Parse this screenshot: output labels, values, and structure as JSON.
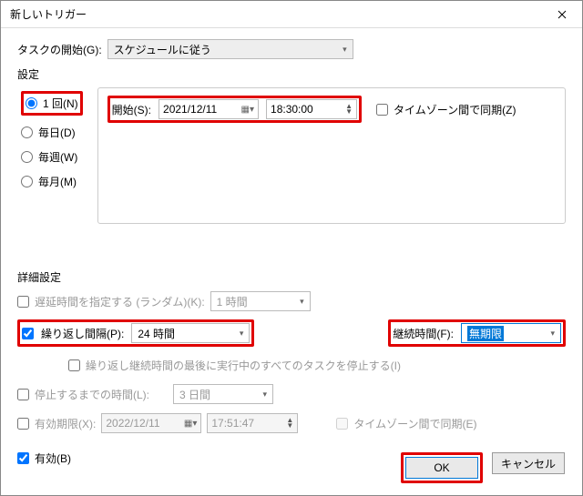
{
  "titlebar": {
    "title": "新しいトリガー"
  },
  "begin": {
    "label": "タスクの開始(G):",
    "value": "スケジュールに従う"
  },
  "settings": {
    "label": "設定",
    "radios": {
      "once": "1 回(N)",
      "daily": "毎日(D)",
      "weekly": "毎週(W)",
      "monthly": "毎月(M)"
    },
    "start": {
      "label": "開始(S):",
      "date": "2021/12/11",
      "time": "18:30:00",
      "sync_label": "タイムゾーン間で同期(Z)"
    }
  },
  "advanced": {
    "label": "詳細設定",
    "delay": {
      "label": "遅延時間を指定する (ランダム)(K):",
      "value": "1 時間"
    },
    "repeat": {
      "label": "繰り返し間隔(P):",
      "value": "24 時間",
      "duration_label": "継続時間(F):",
      "duration_value": "無期限"
    },
    "stop_all": {
      "label": "繰り返し継続時間の最後に実行中のすべてのタスクを停止する(I)"
    },
    "stop_after": {
      "label": "停止するまでの時間(L):",
      "value": "3 日間"
    },
    "expire": {
      "label": "有効期限(X):",
      "date": "2022/12/11",
      "time": "17:51:47",
      "sync_label": "タイムゾーン間で同期(E)"
    },
    "enabled": {
      "label": "有効(B)"
    }
  },
  "buttons": {
    "ok": "OK",
    "cancel": "キャンセル"
  }
}
